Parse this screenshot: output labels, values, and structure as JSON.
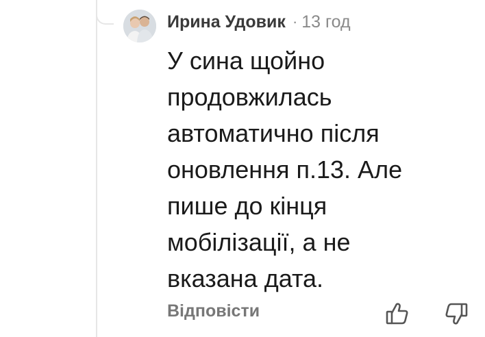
{
  "comment": {
    "author": "Ирина Удовик",
    "separator": "·",
    "timestamp": "13 год",
    "lines": [
      "У сина щойно",
      "продовжилась",
      "автоматично після",
      "оновлення п.13. Але",
      "пише до кінця",
      "мобілізації, а не",
      "вказана дата."
    ],
    "reply_label": "Відповісти"
  },
  "icons": {
    "like": "thumb-up-icon",
    "dislike": "thumb-down-icon"
  },
  "colors": {
    "author": "#3a3a3a",
    "meta": "#8a8a8a",
    "body_text": "#1a1a1a",
    "reply": "#777777",
    "icon": "#555555",
    "thread_line": "#e6e6e6"
  }
}
